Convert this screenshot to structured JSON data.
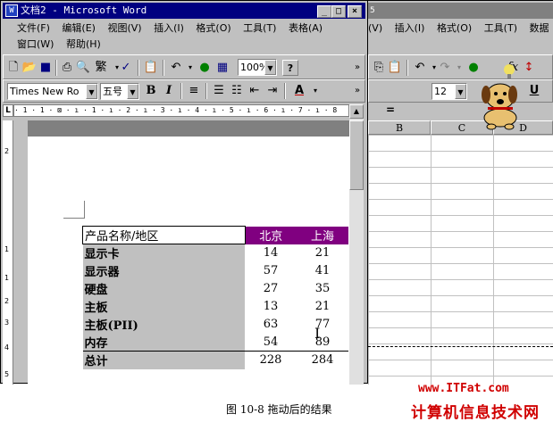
{
  "word": {
    "title": "文档2 - Microsoft Word",
    "title_buttons": [
      "_",
      "□",
      "×"
    ],
    "menu_row1": [
      "文件(F)",
      "编辑(E)",
      "视图(V)",
      "插入(I)",
      "格式(O)",
      "工具(T)",
      "表格(A)"
    ],
    "menu_row2": [
      "窗口(W)",
      "帮助(H)"
    ],
    "font_name": "Times New Ro",
    "font_size": "五号",
    "zoom": "100%",
    "ruler_text": "· 1 · 1 · ⊠ · ı · 1 · ı · 2 · ı · 3 · ı · 4 · ı · 5 · ı · 6 · ı · 7 · ı · 8",
    "vruler_marks": [
      "2",
      "1",
      "1",
      "2",
      "3",
      "4",
      "5"
    ]
  },
  "excel": {
    "title_fragment": "5",
    "menu": [
      "(V)",
      "插入(I)",
      "格式(O)",
      "工具(T)",
      "数据"
    ],
    "font_size": "12",
    "formula_eq": "=",
    "columns": [
      "B",
      "C",
      "D"
    ]
  },
  "table": {
    "header": {
      "name": "产品名称/地区",
      "cities": [
        "北京",
        "上海"
      ]
    },
    "rows": [
      {
        "name": "显示卡",
        "values": [
          "14",
          "21"
        ]
      },
      {
        "name": "显示器",
        "values": [
          "57",
          "41"
        ]
      },
      {
        "name": "硬盘",
        "values": [
          "27",
          "35"
        ]
      },
      {
        "name": "主板",
        "values": [
          "13",
          "21"
        ]
      },
      {
        "name": "主板(PII)",
        "values": [
          "63",
          "77"
        ]
      },
      {
        "name": "内存",
        "values": [
          "54",
          "89"
        ]
      }
    ],
    "total": {
      "name": "总计",
      "values": [
        "228",
        "284"
      ]
    }
  },
  "caption": "图 10-8  拖动后的结果",
  "watermark": {
    "url": "www.ITFat.com",
    "name": "计算机信息技术网"
  }
}
